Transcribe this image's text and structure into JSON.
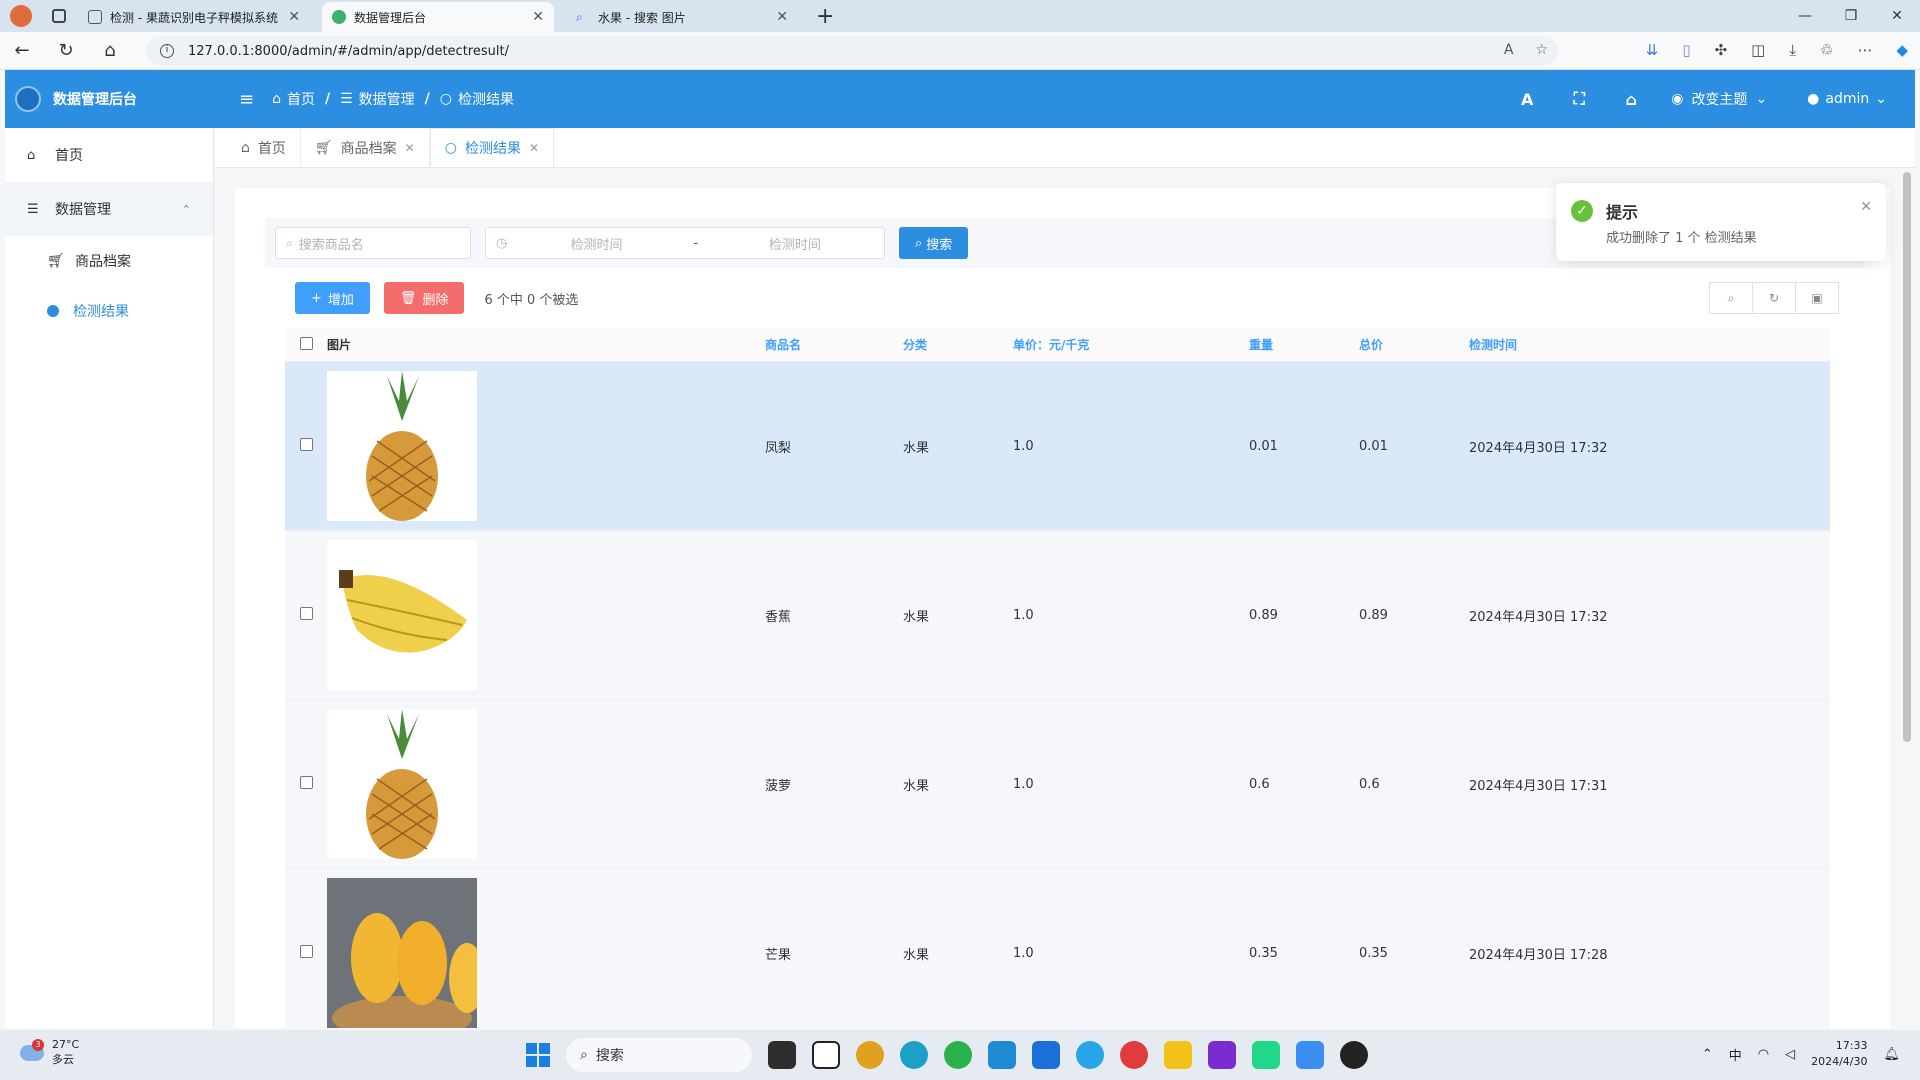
{
  "browser": {
    "tabs": [
      {
        "title": "检测 - 果蔬识别电子秤模拟系统",
        "active": false
      },
      {
        "title": "数据管理后台",
        "active": true
      },
      {
        "title": "水果 - 搜索 图片",
        "active": false
      }
    ],
    "url": "127.0.0.1:8000/admin/#/admin/app/detectresult/"
  },
  "header": {
    "brand": "数据管理后台",
    "breadcrumb": [
      "首页",
      "数据管理",
      "检测结果"
    ],
    "theme_label": "改变主题",
    "user": "admin",
    "accent": "#2c8ee0"
  },
  "sidebar": {
    "home": "首页",
    "group": "数据管理",
    "items": [
      {
        "label": "商品档案",
        "active": false
      },
      {
        "label": "检测结果",
        "active": true
      }
    ]
  },
  "page_tabs": [
    {
      "label": "首页",
      "closable": false,
      "active": false
    },
    {
      "label": "商品档案",
      "closable": true,
      "active": false
    },
    {
      "label": "检测结果",
      "closable": true,
      "active": true
    }
  ],
  "search": {
    "name_placeholder": "搜索商品名",
    "date_start_placeholder": "检测时间",
    "date_separator": "-",
    "date_end_placeholder": "检测时间",
    "button": "搜索"
  },
  "actions": {
    "add": "增加",
    "delete": "删除",
    "selection_info": "6 个中 0 个被选"
  },
  "table": {
    "headers": {
      "image": "图片",
      "name": "商品名",
      "category": "分类",
      "price": "单价：元/千克",
      "weight": "重量",
      "total": "总价",
      "time": "检测时间"
    },
    "rows": [
      {
        "image": "pineapple",
        "name": "凤梨",
        "category": "水果",
        "price": "1.0",
        "weight": "0.01",
        "total": "0.01",
        "time": "2024年4月30日 17:32"
      },
      {
        "image": "banana",
        "name": "香蕉",
        "category": "水果",
        "price": "1.0",
        "weight": "0.89",
        "total": "0.89",
        "time": "2024年4月30日 17:32"
      },
      {
        "image": "pineapple",
        "name": "菠萝",
        "category": "水果",
        "price": "1.0",
        "weight": "0.6",
        "total": "0.6",
        "time": "2024年4月30日 17:31"
      },
      {
        "image": "mango",
        "name": "芒果",
        "category": "水果",
        "price": "1.0",
        "weight": "0.35",
        "total": "0.35",
        "time": "2024年4月30日 17:28"
      }
    ]
  },
  "toast": {
    "title": "提示",
    "message": "成功删除了 1 个 检测结果"
  },
  "taskbar": {
    "weather_temp": "27°C",
    "weather_desc": "多云",
    "weather_badge": "3",
    "search": "搜索",
    "ime": "中",
    "time": "17:33",
    "date": "2024/4/30"
  }
}
